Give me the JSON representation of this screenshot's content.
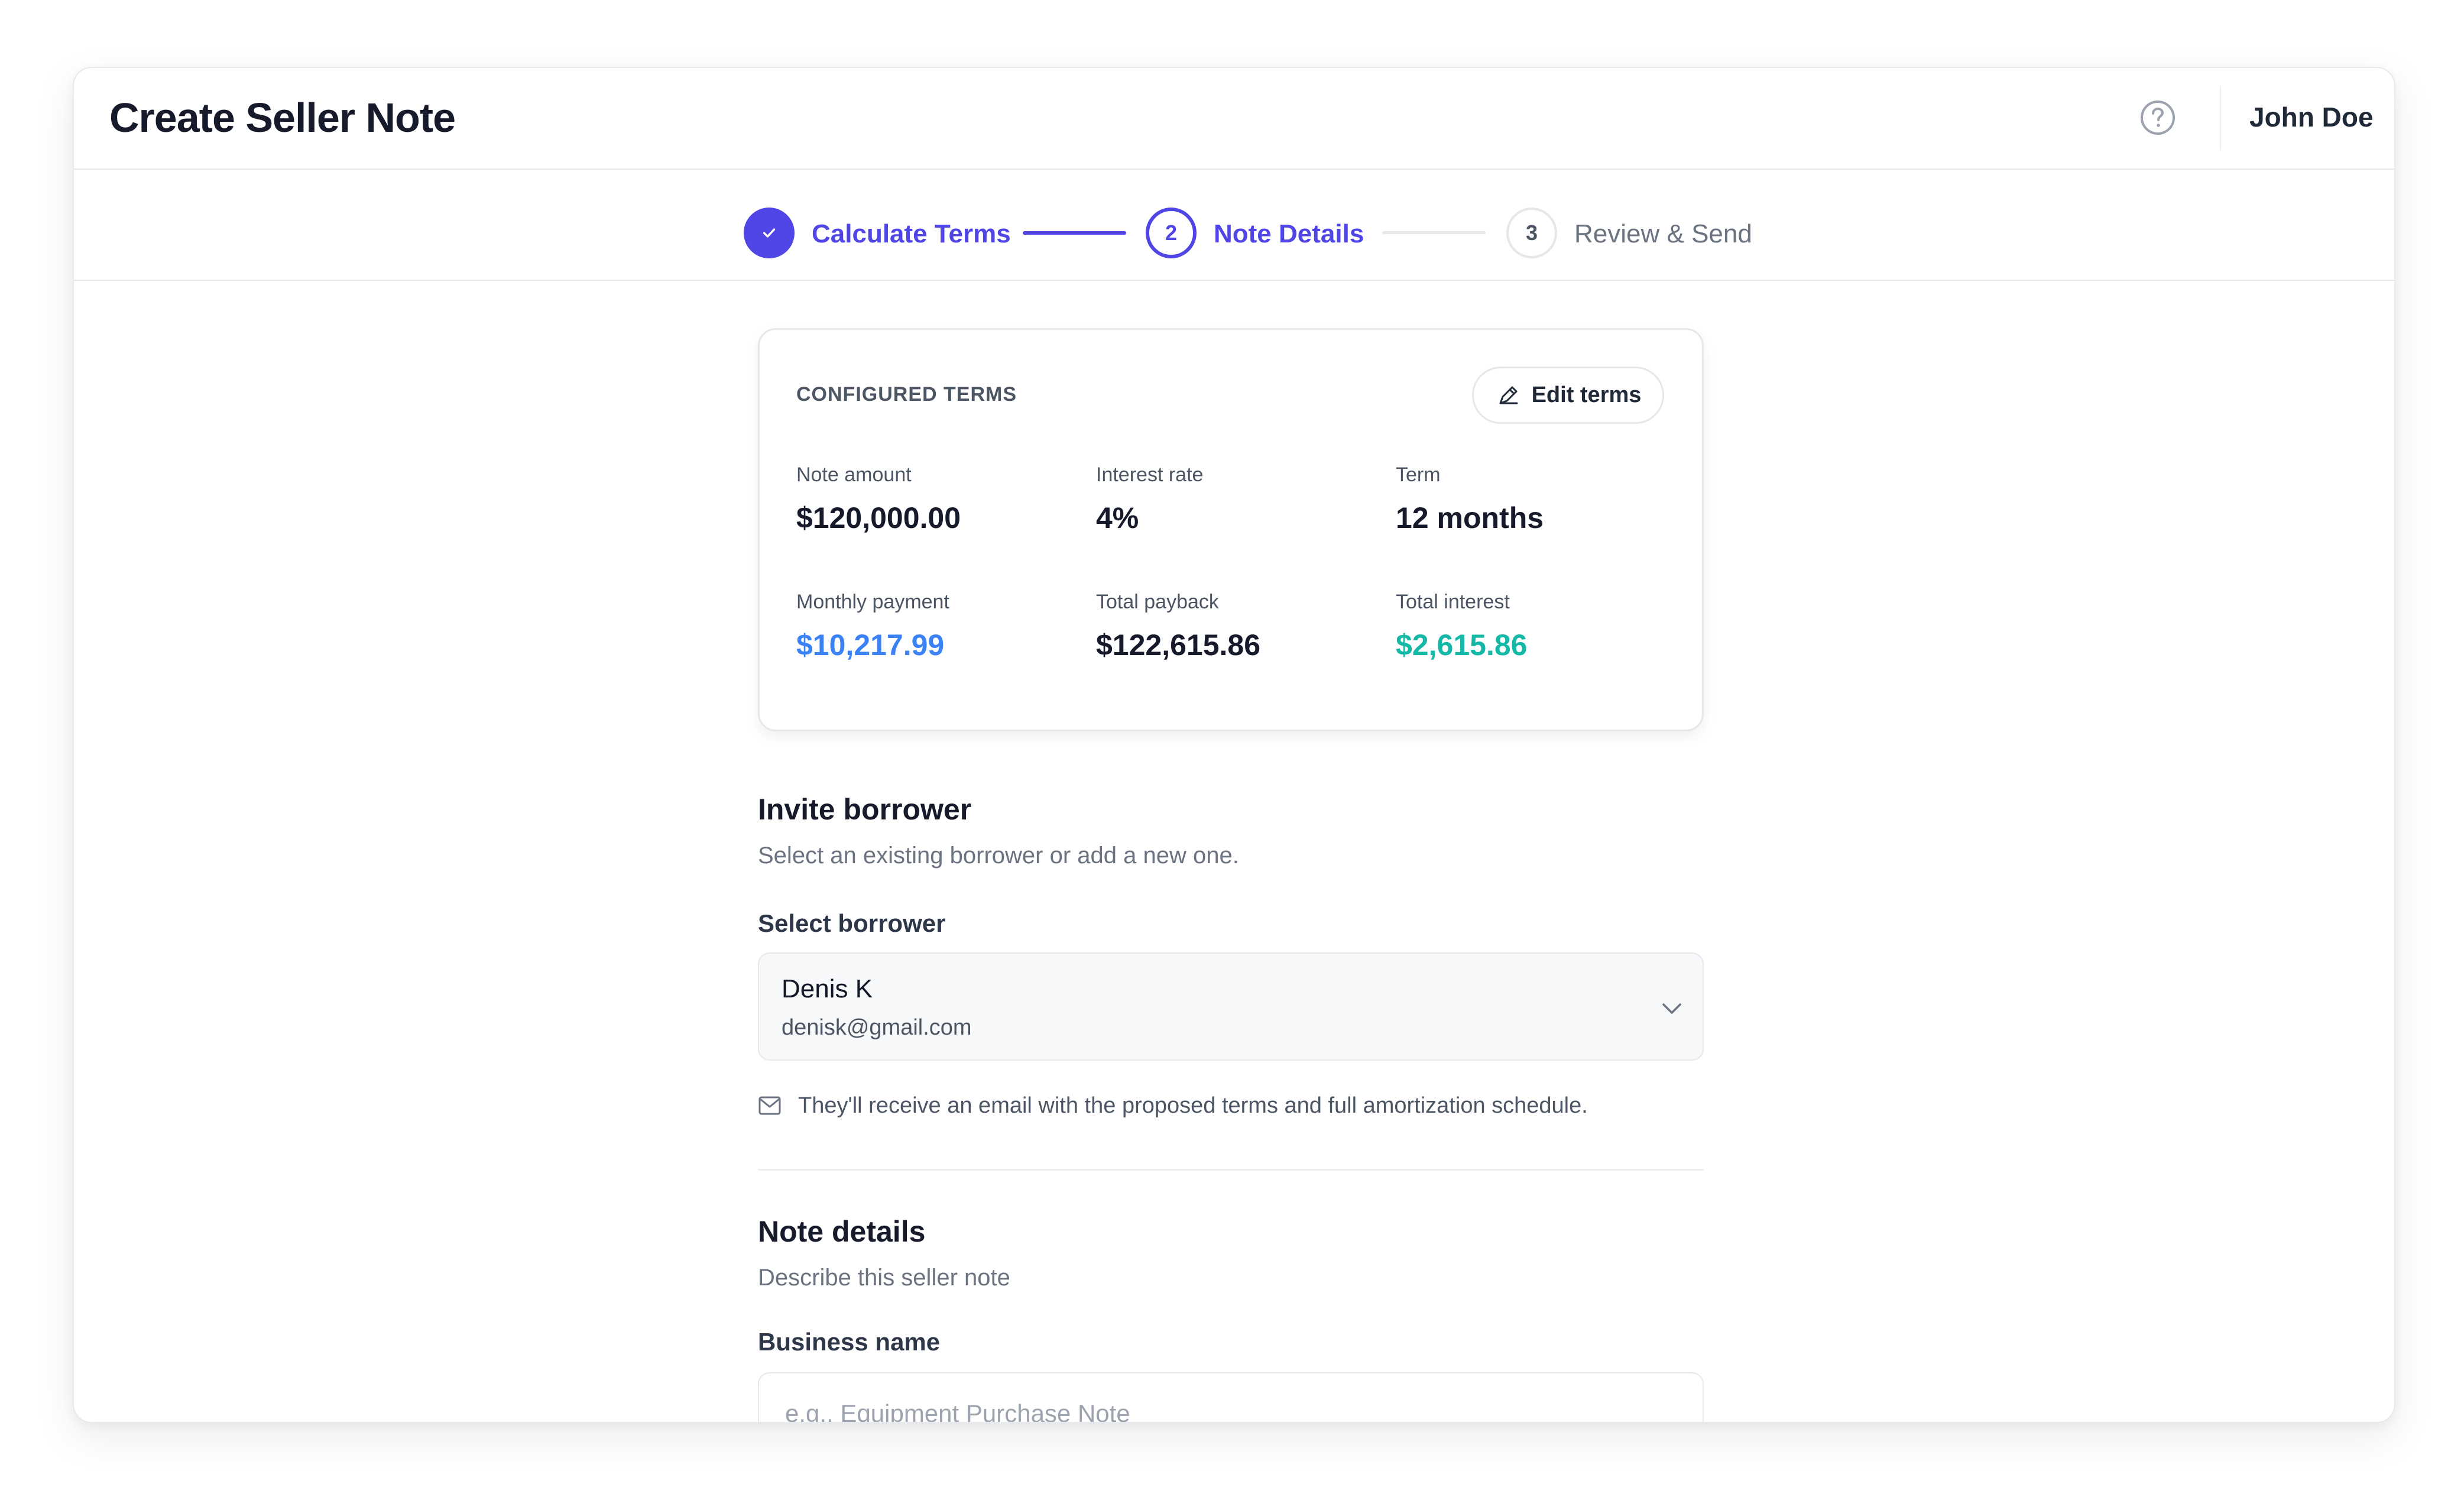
{
  "app": {
    "title": "Create Seller Note",
    "user_name": "John Doe",
    "help_icon": "help-circle-icon"
  },
  "stepper": {
    "steps": [
      {
        "number": "1",
        "label": "Calculate Terms",
        "status": "completed"
      },
      {
        "number": "2",
        "label": "Note Details",
        "status": "current"
      },
      {
        "number": "3",
        "label": "Review & Send",
        "status": "upcoming"
      }
    ]
  },
  "configured_terms": {
    "label": "CONFIGURED TERMS",
    "edit_button": "Edit terms",
    "metrics": {
      "note_amount": {
        "label": "Note amount",
        "value": "$120,000.00"
      },
      "interest_rate": {
        "label": "Interest rate",
        "value": "4%"
      },
      "term": {
        "label": "Term",
        "value": "12 months"
      },
      "monthly_payment": {
        "label": "Monthly payment",
        "value": "$10,217.99"
      },
      "total_payback": {
        "label": "Total payback",
        "value": "$122,615.86"
      },
      "total_interest": {
        "label": "Total interest",
        "value": "$2,615.86"
      }
    }
  },
  "invite_borrower": {
    "title": "Invite borrower",
    "subtitle": "Select an existing borrower or add a new one.",
    "select_label": "Select borrower",
    "selected": {
      "name": "Denis K",
      "email": "denisk@gmail.com"
    },
    "notice": "They'll receive an email with the proposed terms and full amortization schedule."
  },
  "note_details": {
    "title": "Note details",
    "subtitle": "Describe this seller note",
    "business_name_label": "Business name",
    "business_name_value": "",
    "business_name_placeholder": "e.g., Equipment Purchase Note"
  },
  "colors": {
    "accent": "#4f46e5",
    "blue": "#3b82f6",
    "green": "#14b8a6"
  }
}
